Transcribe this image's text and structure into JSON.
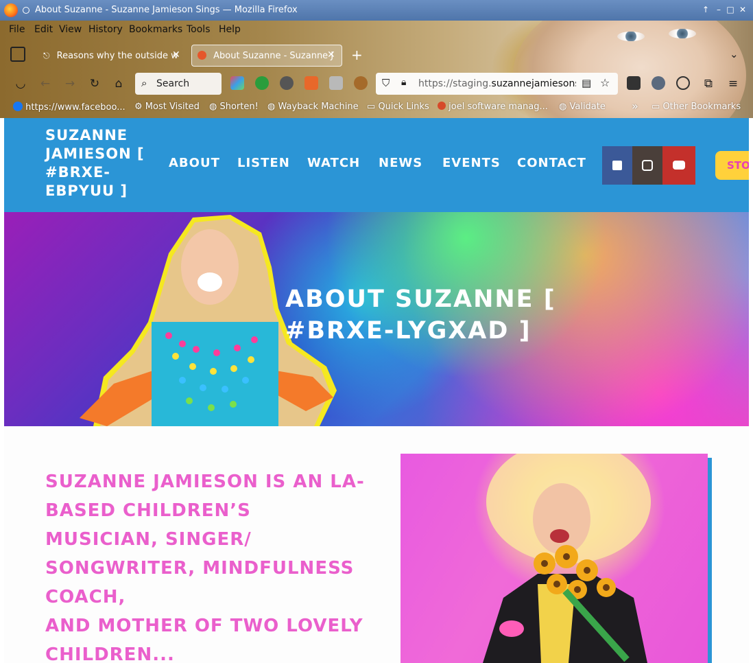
{
  "window": {
    "title": "About Suzanne - Suzanne Jamieson Sings — Mozilla Firefox",
    "controls": [
      "↑",
      "–",
      "□",
      "✕"
    ]
  },
  "menu": [
    "File",
    "Edit",
    "View",
    "History",
    "Bookmarks",
    "Tools",
    "Help"
  ],
  "tabs": [
    {
      "label": "Reasons why the outside w",
      "icon": "website-icon",
      "active": false
    },
    {
      "label": "About Suzanne - Suzanne J",
      "icon": "site-favicon",
      "active": true
    }
  ],
  "toolbar": {
    "search_label": "Search",
    "url_prefix": "https://staging.",
    "url_domain": "suzannejamiesonsi"
  },
  "bookmarks": [
    {
      "label": "https://www.faceboo...",
      "icon": "facebook-icon"
    },
    {
      "label": "Most Visited",
      "icon": "gear-icon"
    },
    {
      "label": "Shorten!",
      "icon": "globe-icon"
    },
    {
      "label": "Wayback Machine",
      "icon": "globe-icon"
    },
    {
      "label": "Quick Links",
      "icon": "folder-icon"
    },
    {
      "label": "joel software manag...",
      "icon": "site-icon"
    },
    {
      "label": "Validate",
      "icon": "globe-icon"
    },
    {
      "label": "Other Bookmarks",
      "icon": "folder-icon"
    }
  ],
  "site": {
    "logo": "Suzanne Jamieson [ #BRXE-EBPYUU ]",
    "nav": [
      "About",
      "Listen",
      "Watch",
      "News",
      "Events",
      "Contact"
    ],
    "social": [
      {
        "name": "facebook",
        "color": "#3b5998"
      },
      {
        "name": "instagram",
        "color": "#4a3f3a"
      },
      {
        "name": "youtube",
        "color": "#c4302b"
      }
    ],
    "store_label": "Sto"
  },
  "hero": {
    "title": "About Suzanne [ #BRXE-LYGXAD ]"
  },
  "about": {
    "lead": "Suzanne Jamieson is an LA-based children’s musician, singer/ songwriter, mindfulness coach,",
    "lead2": "and mother of two lovely children..."
  },
  "colors": {
    "header_bg": "#2b95d6",
    "accent_pink": "#ea5fcc",
    "store_bg": "#ffd13b"
  }
}
